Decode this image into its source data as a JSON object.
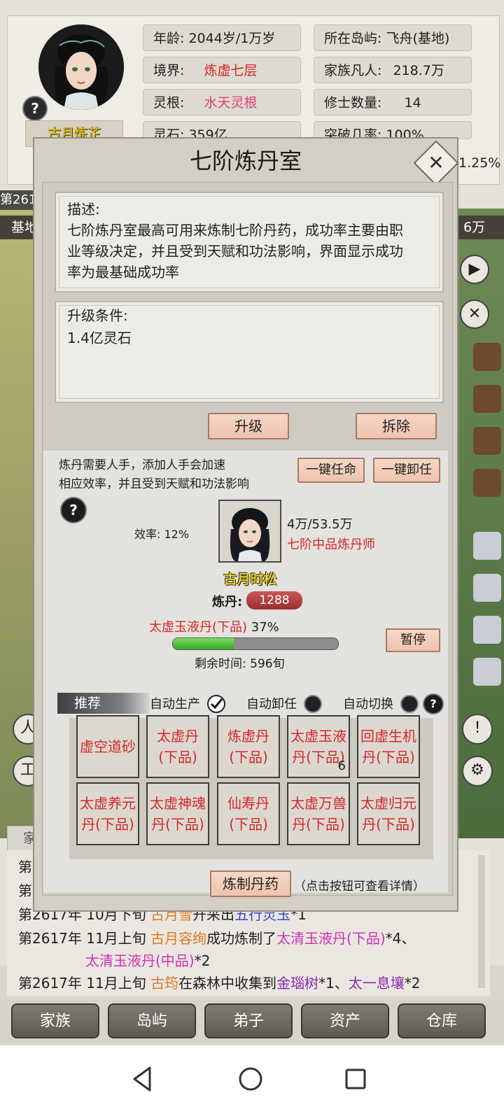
{
  "header": {
    "character_name": "古月炼芷",
    "stats": {
      "age": "年龄: 2044岁/1万岁",
      "realm_label": "境界:",
      "realm_value": "炼虚七层",
      "root_label": "灵根:",
      "root_value": "水天灵根",
      "stones": "灵石:    359亿",
      "island": "所在岛屿: 飞舟(基地)",
      "mortals_label": "家族凡人:",
      "mortals_value": "218.7万",
      "cultivators_label": "修士数量:",
      "cultivators_value": "14",
      "breakthrough": "突破几率:    100%",
      "clipped_right": "1.25%"
    }
  },
  "background": {
    "left_date_clip": "第261",
    "base_label": "基地",
    "right_value": "6万"
  },
  "modal": {
    "title": "七阶炼丹室",
    "description_label": "描述:",
    "description_lines": [
      "七阶炼丹室最高可用来炼制七阶丹药，成功率主要由职",
      "业等级决定，并且受到天赋和功法影响，界面显示成功",
      "率为最基础成功率"
    ],
    "upgrade_label": "升级条件:",
    "upgrade_cost": "1.4亿灵石",
    "upgrade_button": "升级",
    "demolish_button": "拆除",
    "work": {
      "note_line1": "炼丹需要人手，添加人手会加速",
      "note_line2": "相应效率，并且受到天赋和功法影响",
      "appoint_all": "一键任命",
      "dismiss_all": "一键卸任",
      "efficiency": "效率: 12%",
      "worker_exp": "4万/53.5万",
      "worker_rank": "七阶中品炼丹师",
      "worker_name": "古月时松",
      "skill_label": "炼丹:",
      "skill_value": "1288",
      "current_product": "太虚玉液丹(下品)",
      "current_percent": "37%",
      "progress": 0.37,
      "remaining": "剩余时间: 596旬",
      "pause_button": "暂停"
    },
    "options": {
      "recommend": "推荐",
      "auto_produce": "自动生产",
      "auto_produce_on": true,
      "auto_dismiss": "自动卸任",
      "auto_switch": "自动切换"
    },
    "recipes": [
      {
        "l1": "虚空道砂",
        "l2": "",
        "count": ""
      },
      {
        "l1": "太虚丹",
        "l2": "(下品)",
        "count": ""
      },
      {
        "l1": "炼虚丹",
        "l2": "(下品)",
        "count": ""
      },
      {
        "l1": "太虚玉液",
        "l2": "丹(下品)",
        "count": "6"
      },
      {
        "l1": "回虚生机",
        "l2": "丹(下品)",
        "count": ""
      },
      {
        "l1": "太虚养元",
        "l2": "丹(下品)",
        "count": ""
      },
      {
        "l1": "太虚神魂",
        "l2": "丹(下品)",
        "count": ""
      },
      {
        "l1": "仙寿丹",
        "l2": "(下品)",
        "count": ""
      },
      {
        "l1": "太虚万兽",
        "l2": "丹(下品)",
        "count": ""
      },
      {
        "l1": "太虚归元",
        "l2": "丹(下品)",
        "count": ""
      }
    ],
    "craft_button": "炼制丹药",
    "craft_hint": "（点击按钮可查看详情）"
  },
  "log": {
    "clip1": "第",
    "clip2": "第",
    "line1": {
      "date": "第2617年 10月下旬 ",
      "name": "古月雪",
      "verb": "开采出",
      "item": "五行灵玉",
      "tail": "*1"
    },
    "line2": {
      "date": "第2617年 11月上旬 ",
      "name": "古月容绚",
      "verb": "成功炼制了",
      "item": "太清玉液丹(下品)",
      "tail": "*4、"
    },
    "line2b": {
      "item": "太清玉液丹(中品)",
      "tail": "*2"
    },
    "line3": {
      "date": "第2617年 11月上旬 ",
      "name": "古筠",
      "verb": "在森林中收集到",
      "item1": "金瑙树",
      "sep": "*1、",
      "item2": "太一息壤",
      "tail": "*2"
    }
  },
  "nav": [
    "家族",
    "岛屿",
    "弟子",
    "资产",
    "仓库"
  ],
  "side_clip": "家"
}
